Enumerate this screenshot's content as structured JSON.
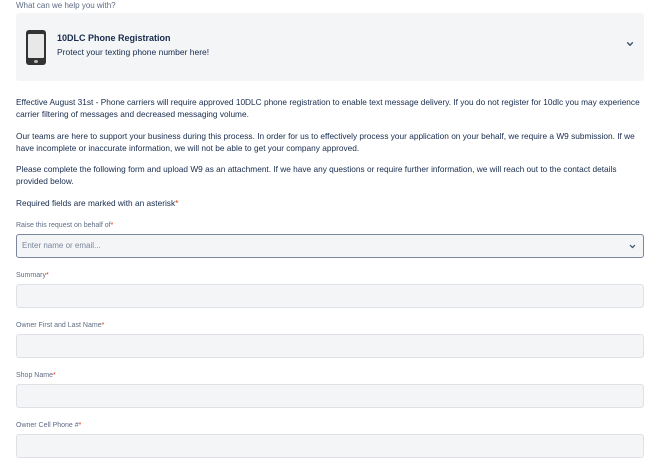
{
  "request_type": {
    "section_label": "What can we help you with?",
    "title": "10DLC Phone Registration",
    "subtitle": "Protect your texting phone number here!",
    "icon": "phone-icon"
  },
  "intro": {
    "paragraph1": "Effective August 31st - Phone carriers will require approved 10DLC phone registration to enable text message delivery. If you do not register for 10dlc you may experience carrier filtering of messages and decreased messaging volume.",
    "paragraph2": "Our teams are here to support your business during this process. In order for us to effectively process your application on your behalf, we require a W9 submission. If we have incomplete or inaccurate information, we will not be able to get your company approved.",
    "paragraph3": "Please complete the following form and upload W9 as an attachment. If we have any questions or require further information, we will reach out to the contact details provided below.",
    "required_note": "Required fields are marked with an asterisk",
    "asterisk": "*"
  },
  "form": {
    "on_behalf": {
      "label": "Raise this request on behalf of",
      "placeholder": "Enter name or email..."
    },
    "summary": {
      "label": "Summary",
      "value": ""
    },
    "owner_name": {
      "label": "Owner First and Last Name",
      "value": ""
    },
    "shop_name": {
      "label": "Shop Name",
      "value": ""
    },
    "owner_phone": {
      "label": "Owner Cell Phone #",
      "value": ""
    }
  },
  "colors": {
    "text": "#172b4d",
    "muted": "#5e6c84",
    "required": "#de350b",
    "field_bg": "#f4f5f7"
  }
}
